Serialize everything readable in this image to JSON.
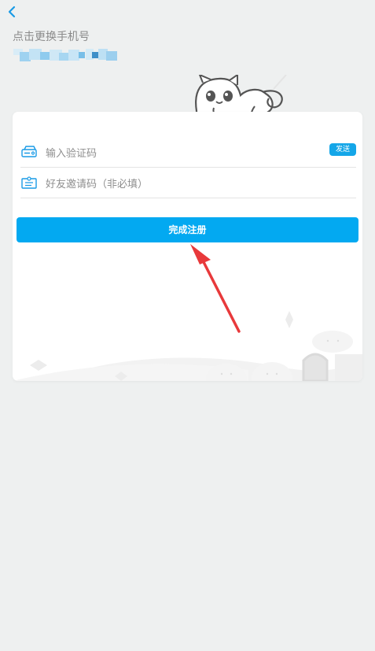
{
  "header": {
    "back_icon": "chevron-left-icon",
    "title": "点击更换手机号"
  },
  "form": {
    "code_placeholder": "输入验证码",
    "send_label": "发送",
    "invite_placeholder": "好友邀请码（非必填）",
    "submit_label": "完成注册"
  },
  "colors": {
    "accent": "#03a9f1",
    "back_icon": "#1a9be6",
    "background": "#eef0f0",
    "arrow": "#e8393b"
  }
}
